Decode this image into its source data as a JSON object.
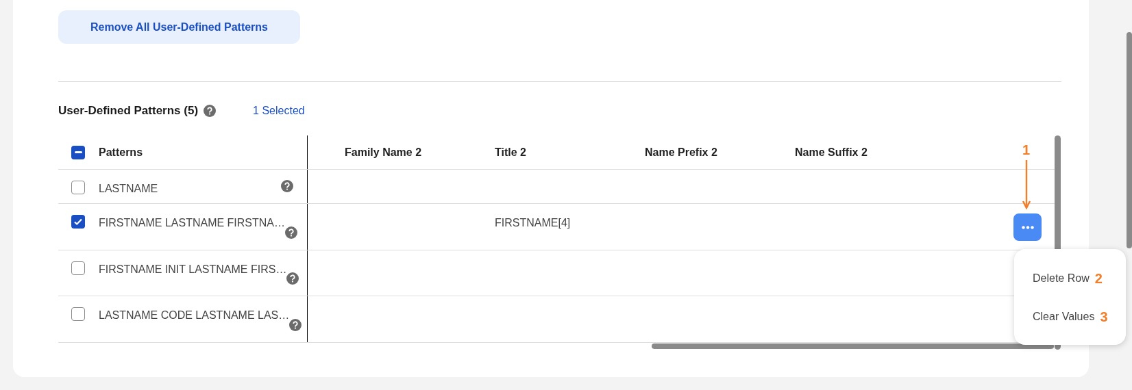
{
  "remove_button": "Remove All User-Defined Patterns",
  "section": {
    "title": "User-Defined Patterns (5)",
    "selection_count": "1 Selected"
  },
  "table": {
    "select_all": {
      "indeterminate": true
    },
    "columns": [
      "Patterns",
      "Family Name 2",
      "Title 2",
      "Name Prefix 2",
      "Name Suffix 2"
    ],
    "rows": [
      {
        "pattern": "LASTNAME",
        "selected": false,
        "actions_shown": false
      },
      {
        "pattern": "FIRSTNAME LASTNAME FIRSTNA…",
        "selected": true,
        "actions_shown": true,
        "title_2": "FIRSTNAME[4]"
      },
      {
        "pattern": "FIRSTNAME INIT LASTNAME FIRS…",
        "selected": false,
        "actions_shown": false
      },
      {
        "pattern": "LASTNAME CODE LASTNAME LAS…",
        "selected": false,
        "actions_shown": false
      }
    ]
  },
  "row_menu": {
    "open": true,
    "button_annotation": "1",
    "items": [
      {
        "label": "Delete Row",
        "annotation": "2"
      },
      {
        "label": "Clear Values",
        "annotation": "3"
      }
    ]
  }
}
